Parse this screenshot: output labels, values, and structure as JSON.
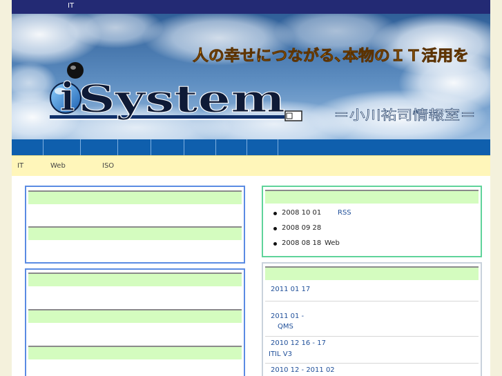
{
  "topbar": {
    "text": "IT"
  },
  "banner": {
    "logo_i": "i",
    "logo_rest": "System",
    "tagline": "人の幸せにつながる､本物のＩＴ活用を",
    "subtitle": "＝小川祐司情報室＝"
  },
  "breadcrumbs": [
    "IT",
    "Web",
    "ISO"
  ],
  "news": {
    "items": [
      {
        "date": "2008 10 01",
        "text": "RSS"
      },
      {
        "date": "2008 09 28",
        "text": ""
      },
      {
        "date": "2008 08 18",
        "text": "Web"
      }
    ]
  },
  "events": {
    "items": [
      {
        "date": "2011 01 17",
        "text": ""
      },
      {
        "date": "2011 01 -",
        "text": "QMS"
      },
      {
        "date": "2010 12 16 - 17",
        "text": "ITIL V3"
      },
      {
        "date": "2010 12 - 2011 02",
        "text": ""
      }
    ]
  },
  "colors": {
    "topbar": "#232a74",
    "navbar": "#0f5fad",
    "crumbs_bg": "#fff6ba",
    "box_blue_border": "#5a8be3",
    "box_green_border": "#5fd39a",
    "header_bar": "#d4fcbf",
    "link": "#1f4f99"
  }
}
